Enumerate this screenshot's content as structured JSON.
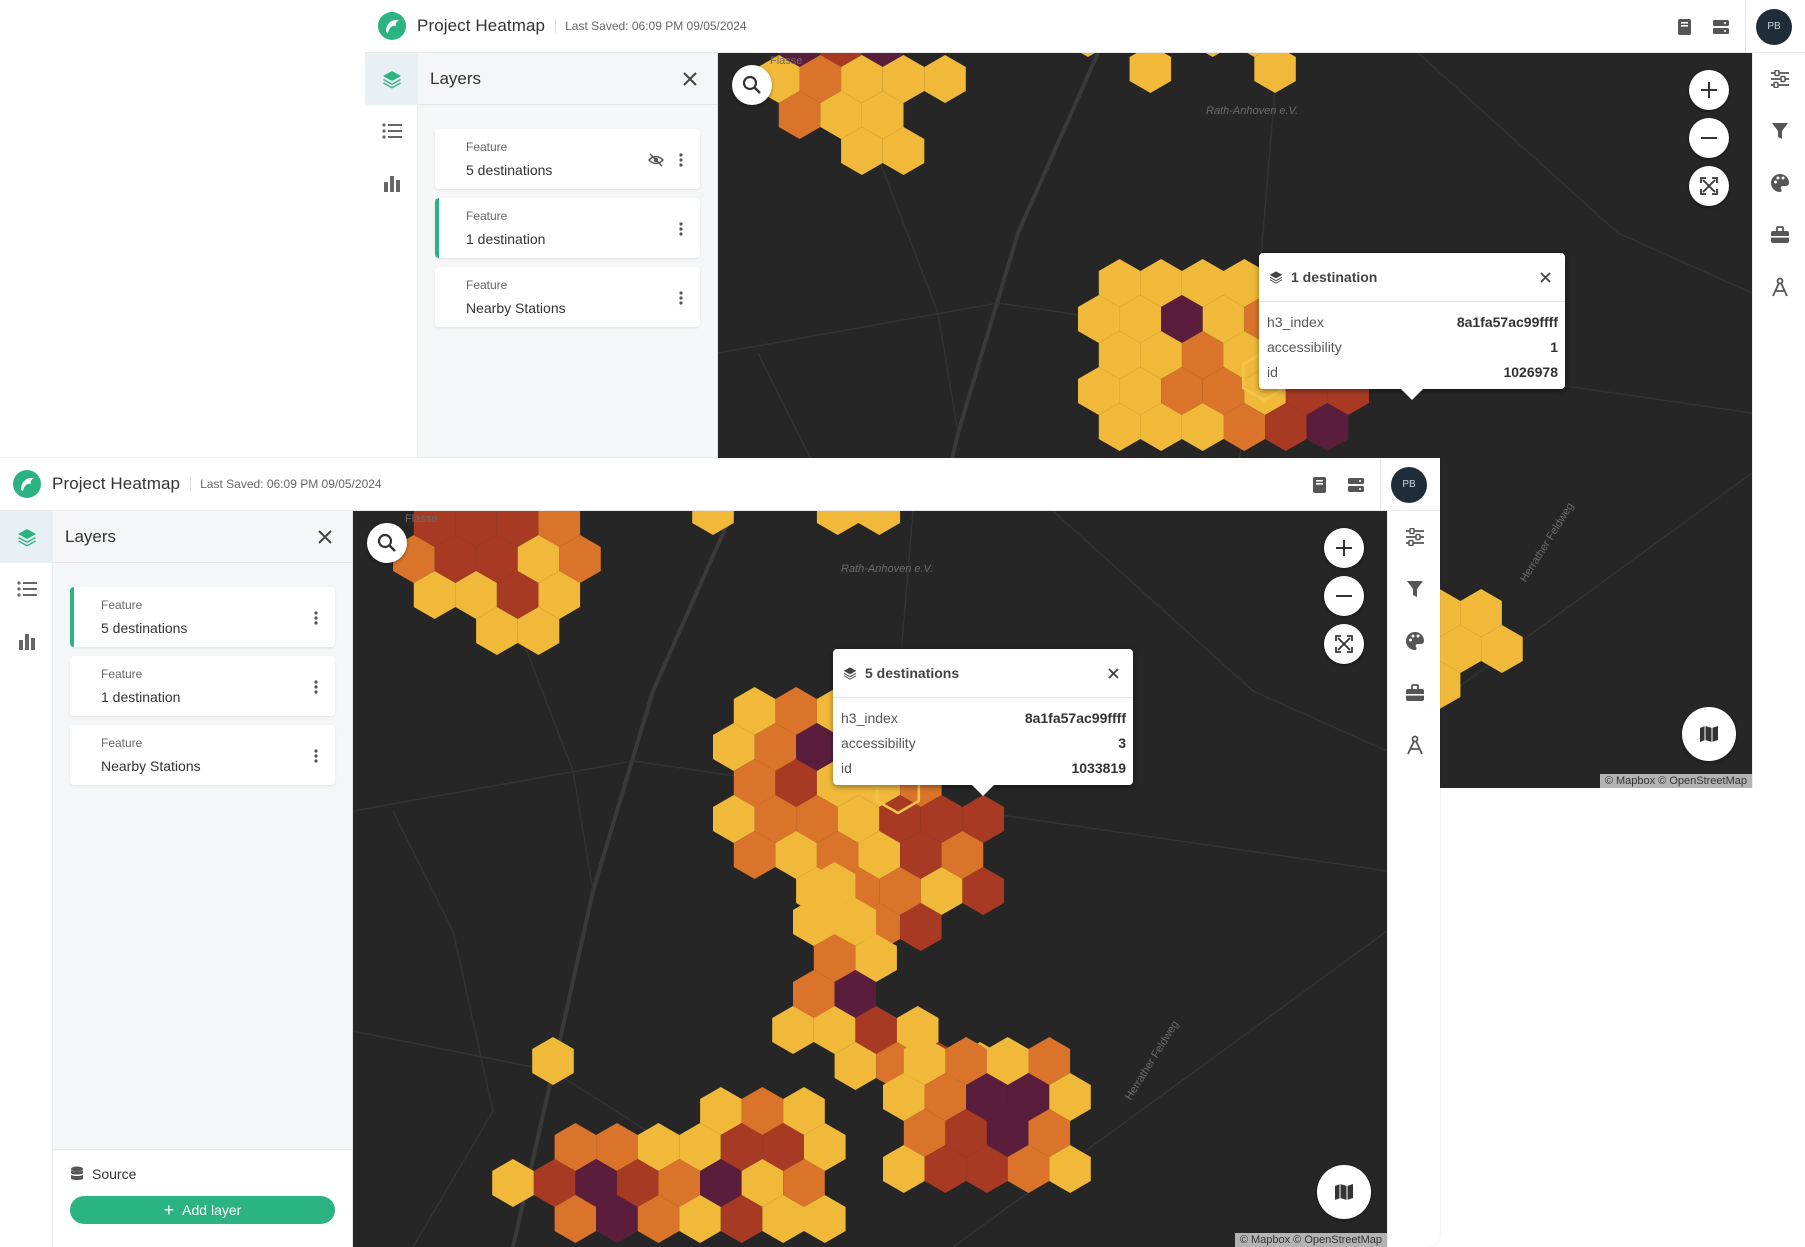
{
  "back_window": {
    "header": {
      "title": "Project Heatmap",
      "last_saved": "Last Saved: 06:09 PM 09/05/2024",
      "avatar_initials": "PB"
    },
    "panel": {
      "title": "Layers",
      "layers": [
        {
          "type": "Feature",
          "name": "5 destinations"
        },
        {
          "type": "Feature",
          "name": "1 destination"
        },
        {
          "type": "Feature",
          "name": "Nearby Stations"
        }
      ]
    },
    "popup": {
      "title": "1 destination",
      "rows": [
        {
          "key": "h3_index",
          "value": "8a1fa57ac99ffff"
        },
        {
          "key": "accessibility",
          "value": "1"
        },
        {
          "key": "id",
          "value": "1026978"
        }
      ]
    },
    "map": {
      "attribution": "© Mapbox © OpenStreetMap",
      "labels": [
        "Flasse",
        "Rath-Anhoven e.V.",
        "Herrather Feldweg"
      ]
    }
  },
  "front_window": {
    "header": {
      "title": "Project Heatmap",
      "last_saved": "Last Saved: 06:09 PM 09/05/2024",
      "avatar_initials": "PB"
    },
    "panel": {
      "title": "Layers",
      "layers": [
        {
          "type": "Feature",
          "name": "5 destinations"
        },
        {
          "type": "Feature",
          "name": "1 destination"
        },
        {
          "type": "Feature",
          "name": "Nearby Stations"
        }
      ],
      "source_label": "Source",
      "add_layer_label": "Add layer"
    },
    "popup": {
      "title": "5 destinations",
      "rows": [
        {
          "key": "h3_index",
          "value": "8a1fa57ac99ffff"
        },
        {
          "key": "accessibility",
          "value": "3"
        },
        {
          "key": "id",
          "value": "1033819"
        }
      ]
    },
    "map": {
      "attribution": "© Mapbox © OpenStreetMap",
      "labels": [
        "Flasse",
        "Rath-Anhoven e.V.",
        "Herrather Feldweg"
      ]
    }
  },
  "colors": {
    "brand_green": "#2bb381",
    "map_background": "#262626",
    "hex_yellow": "#f0b93a",
    "hex_orange": "#d9742a",
    "hex_red": "#a83a24",
    "hex_purple": "#5a1e3c"
  },
  "icons": [
    "logo-icon",
    "layers-icon",
    "list-icon",
    "chart-icon",
    "close-icon",
    "eye-off-icon",
    "kebab-icon",
    "book-icon",
    "server-icon",
    "search-icon",
    "plus-icon",
    "minus-icon",
    "fullscreen-icon",
    "map-icon",
    "sliders-icon",
    "filter-icon",
    "palette-icon",
    "toolbox-icon",
    "compass-icon",
    "database-icon"
  ]
}
